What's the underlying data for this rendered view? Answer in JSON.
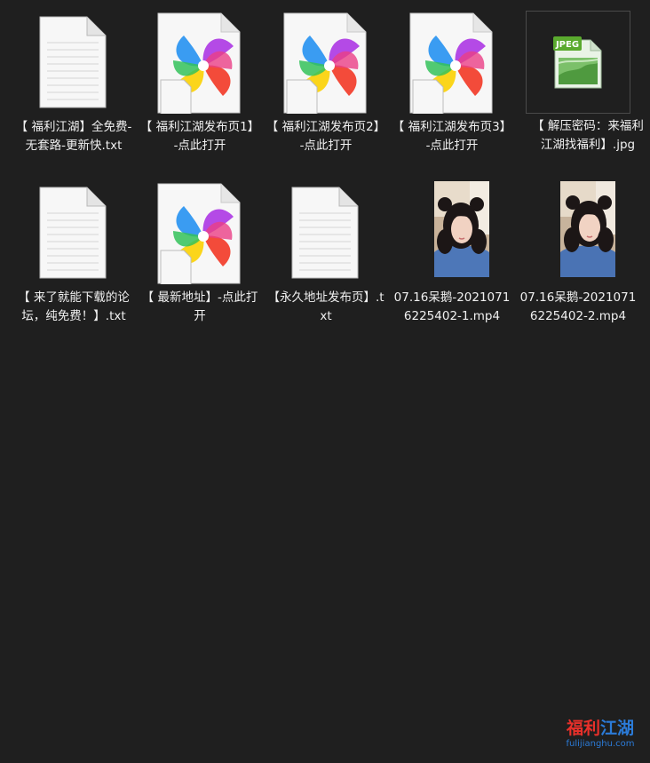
{
  "files": [
    {
      "label": "【 福利江湖】全免费-无套路-更新快.txt",
      "type": "txt",
      "icon": "text-file-icon"
    },
    {
      "label": "【 福利江湖发布页1】-点此打开",
      "type": "shortcut",
      "icon": "pinwheel-shortcut-icon"
    },
    {
      "label": "【 福利江湖发布页2】-点此打开",
      "type": "shortcut",
      "icon": "pinwheel-shortcut-icon"
    },
    {
      "label": "【 福利江湖发布页3】-点此打开",
      "type": "shortcut",
      "icon": "pinwheel-shortcut-icon"
    },
    {
      "label": "【 解压密码：来福利江湖找福利】.jpg",
      "type": "jpg",
      "icon": "jpeg-file-icon",
      "badge": "JPEG"
    },
    {
      "label": "【 来了就能下载的论坛，纯免费！】.txt",
      "type": "txt",
      "icon": "text-file-icon"
    },
    {
      "label": "【 最新地址】-点此打开",
      "type": "shortcut",
      "icon": "pinwheel-shortcut-icon"
    },
    {
      "label": "【永久地址发布页】.txt",
      "type": "txt",
      "icon": "text-file-icon"
    },
    {
      "label": "07.16呆鹅-20210716225402-1.mp4",
      "type": "mp4",
      "icon": "video-thumbnail"
    },
    {
      "label": "07.16呆鹅-20210716225402-2.mp4",
      "type": "mp4",
      "icon": "video-thumbnail"
    }
  ],
  "watermark": {
    "title_part1": "福利",
    "title_part2": "江湖",
    "url": "fulijianghu.com"
  },
  "colors": {
    "background": "#1f1f1f",
    "text": "#f0f0f0",
    "watermark_red": "#e8302a",
    "watermark_blue": "#2b7bd8"
  }
}
